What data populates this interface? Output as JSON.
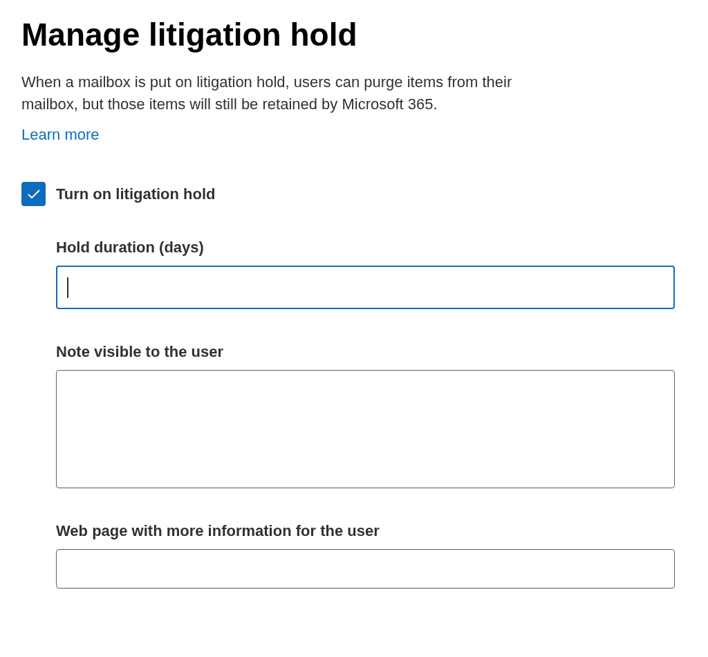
{
  "title": "Manage litigation hold",
  "description": "When a mailbox is put on litigation hold, users can purge items from their mailbox, but those items will still be retained by Microsoft 365.",
  "learn_more": "Learn more",
  "checkbox": {
    "label": "Turn on litigation hold",
    "checked": true
  },
  "fields": [
    {
      "kind": "input",
      "label": "Hold duration (days)",
      "focused": true
    },
    {
      "kind": "textarea",
      "label": "Note visible to the user",
      "focused": false
    },
    {
      "kind": "input",
      "label": "Web page with more information for the user",
      "focused": false
    }
  ]
}
